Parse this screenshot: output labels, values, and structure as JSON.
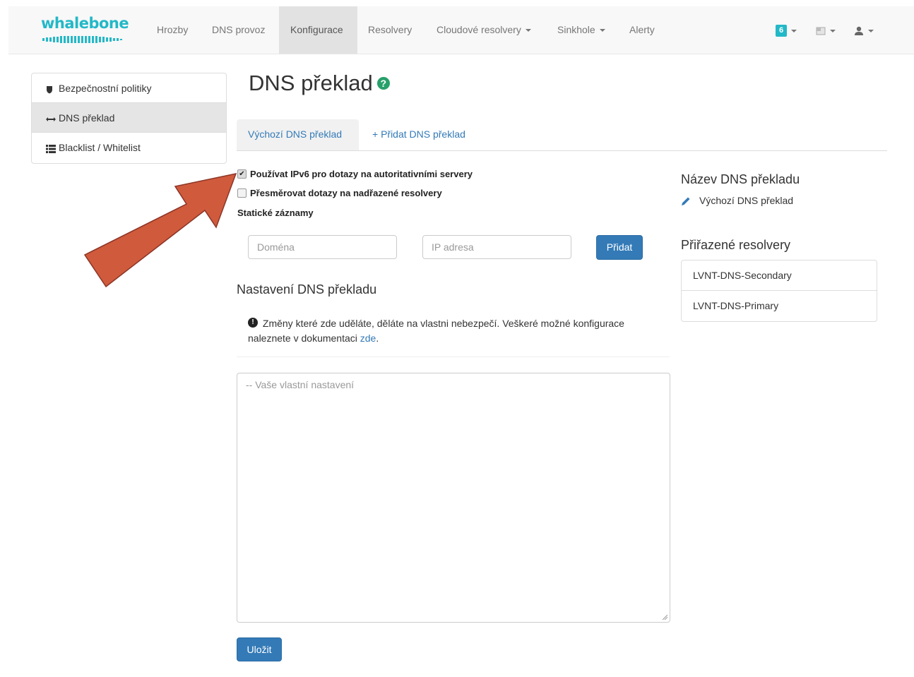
{
  "navbar": {
    "logo_text": "whalebone",
    "items": [
      {
        "label": "Hrozby"
      },
      {
        "label": "DNS provoz"
      },
      {
        "label": "Konfigurace"
      },
      {
        "label": "Resolvery"
      },
      {
        "label": "Cloudové resolvery"
      },
      {
        "label": "Sinkhole"
      },
      {
        "label": "Alerty"
      }
    ],
    "notifications_count": "6",
    "icons": [
      "notification-badge",
      "flag-icon",
      "user-icon"
    ]
  },
  "sidebar": {
    "items": [
      {
        "label": "Bezpečnostní politiky",
        "icon": "shield-icon"
      },
      {
        "label": "DNS překlad",
        "icon": "arrows-h-icon"
      },
      {
        "label": "Blacklist / Whitelist",
        "icon": "list-icon"
      }
    ]
  },
  "page": {
    "title": "DNS překlad"
  },
  "tabs": [
    {
      "label": "Výchozí DNS překlad"
    },
    {
      "label": "+ Přidat DNS překlad"
    }
  ],
  "options": {
    "ipv6_label": "Používat IPv6 pro dotazy na autoritativními servery",
    "ipv6_checked": true,
    "redirect_label": "Přesměrovat dotazy na nadřazené resolvery",
    "redirect_checked": false,
    "static_records_label": "Statické záznamy"
  },
  "static_form": {
    "domain_placeholder": "Doména",
    "ip_placeholder": "IP adresa",
    "add_button": "Přidat"
  },
  "settings": {
    "title": "Nastavení DNS překladu",
    "warning_text": "Změny které zde uděláte, děláte na vlastni nebezpečí. Veškeré možné konfigurace naleznete v dokumentaci ",
    "warning_link": "zde",
    "warning_end": ".",
    "textarea_placeholder": "-- Vaše vlastní nastavení",
    "save_button": "Uložit"
  },
  "right_panel": {
    "name_title": "Název DNS překladu",
    "name_value": "Výchozí DNS překlad",
    "resolvers_title": "Přiřazené resolvery",
    "resolvers": [
      {
        "name": "LVNT-DNS-Secondary"
      },
      {
        "name": "LVNT-DNS-Primary"
      }
    ]
  },
  "colors": {
    "brand": "#23b8c7",
    "primary": "#337ab7",
    "arrow": "#d05a3c"
  }
}
